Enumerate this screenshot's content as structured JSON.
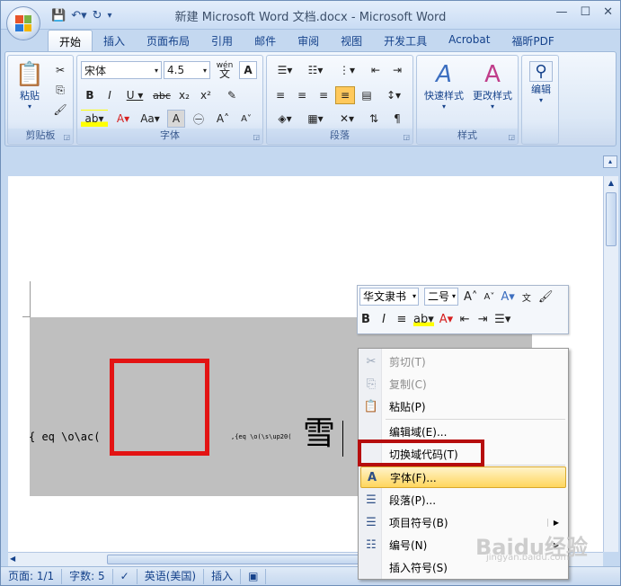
{
  "window": {
    "title": "新建 Microsoft Word 文档.docx - Microsoft Word"
  },
  "tabs": [
    "开始",
    "插入",
    "页面布局",
    "引用",
    "邮件",
    "审阅",
    "视图",
    "开发工具",
    "Acrobat",
    "福昕PDF"
  ],
  "ribbon": {
    "clipboard": {
      "label": "剪贴板",
      "paste": "粘贴"
    },
    "font": {
      "label": "字体",
      "font_name": "宋体",
      "font_size": "4.5",
      "phonetic": "wén"
    },
    "paragraph": {
      "label": "段落"
    },
    "styles": {
      "label": "样式",
      "quick": "快速样式",
      "change": "更改样式"
    },
    "editing": {
      "label": "编辑"
    }
  },
  "mini_toolbar": {
    "font": "华文隶书",
    "size": "二号"
  },
  "document": {
    "field_code_1": "{ eq \\o\\ac(",
    "field_code_2": ",{eq \\o(\\s\\up20(",
    "char": "雪"
  },
  "context_menu": [
    {
      "label": "剪切(T)",
      "icon": "scissors-icon",
      "disabled": true
    },
    {
      "label": "复制(C)",
      "icon": "copy-icon",
      "disabled": true
    },
    {
      "label": "粘贴(P)",
      "icon": "paste-icon",
      "disabled": false
    },
    {
      "label": "编辑域(E)...",
      "icon": "",
      "disabled": false
    },
    {
      "label": "切换域代码(T)",
      "icon": "",
      "disabled": false
    },
    {
      "label": "字体(F)...",
      "icon": "font-icon",
      "disabled": false
    },
    {
      "label": "段落(P)...",
      "icon": "paragraph-icon",
      "disabled": false
    },
    {
      "label": "项目符号(B)",
      "icon": "bullets-icon",
      "disabled": false
    },
    {
      "label": "编号(N)",
      "icon": "numbering-icon",
      "disabled": false
    },
    {
      "label": "插入符号(S)",
      "icon": "",
      "disabled": false
    }
  ],
  "status": {
    "page": "页面: 1/1",
    "words": "字数: 5",
    "lang": "英语(美国)",
    "mode": "插入"
  },
  "watermark": {
    "main": "Baidu经验",
    "sub": "jingyan.baidu.com"
  }
}
